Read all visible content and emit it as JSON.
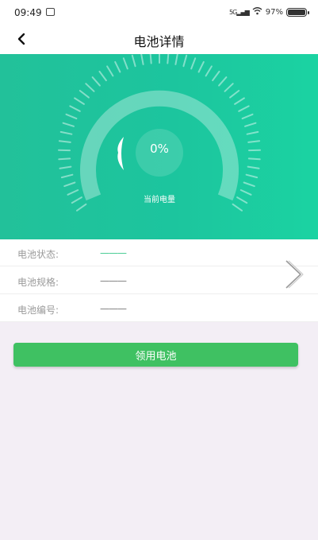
{
  "status_bar": {
    "time": "09:49",
    "network": "5G",
    "battery": "97%"
  },
  "header": {
    "title": "电池详情",
    "back_icon": "back-chevron-icon"
  },
  "gauge": {
    "percent_text": "0%",
    "label": "当前电量",
    "level": 0
  },
  "info": {
    "rows": [
      {
        "label": "电池状态:",
        "value": "———"
      },
      {
        "label": "电池规格:",
        "value": "———"
      },
      {
        "label": "电池编号:",
        "value": "———"
      }
    ]
  },
  "actions": {
    "primary_label": "领用电池"
  },
  "colors": {
    "hero_green": "#1dc59e",
    "button_green": "#3fc162",
    "page_bg": "#f3eef5"
  }
}
